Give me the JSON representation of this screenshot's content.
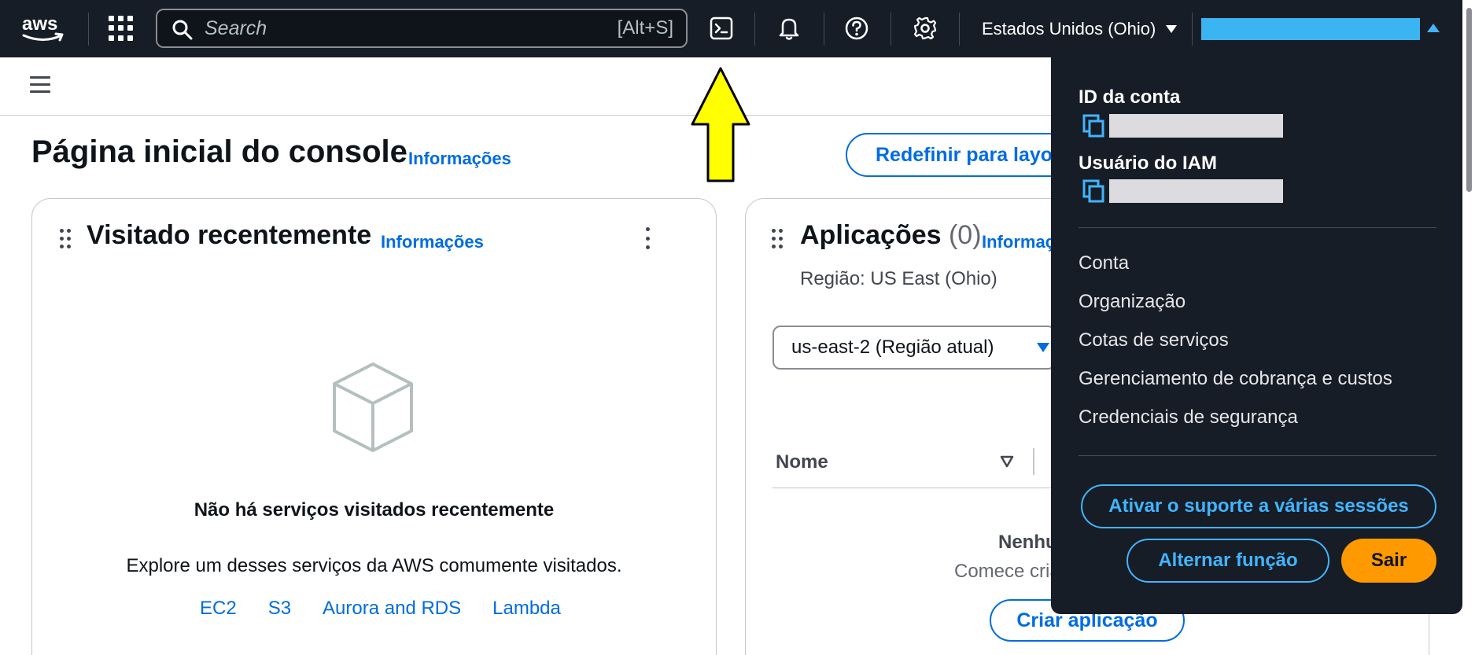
{
  "topnav": {
    "logo_text": "aws",
    "search": {
      "placeholder": "Search",
      "shortcut": "[Alt+S]"
    },
    "region": "Estados Unidos (Ohio)",
    "icons": [
      "services-grid-icon",
      "search-icon",
      "cloudshell-icon",
      "bell-icon",
      "help-icon",
      "gear-icon"
    ],
    "account_bar_color": "#3bb4f2"
  },
  "page": {
    "title": "Página inicial do console",
    "info_link": "Informações",
    "reset_button": "Redefinir para layout padrão"
  },
  "recent_card": {
    "title": "Visitado recentemente",
    "info_link": "Informações",
    "empty_title": "Não há serviços visitados recentemente",
    "empty_desc": "Explore um desses serviços da AWS comumente visitados.",
    "services": [
      "EC2",
      "S3",
      "Aurora and RDS",
      "Lambda"
    ]
  },
  "apps_card": {
    "title": "Aplicações",
    "count": "(0)",
    "info_link": "Informações",
    "region_label": "Região: US East (Ohio)",
    "region_select": "us-east-2 (Região atual)",
    "column_name": "Nome",
    "empty_title": "Nenhuma aplicação",
    "empty_desc": "Comece criando uma aplicação.",
    "create_button": "Criar aplicação"
  },
  "account_menu": {
    "account_id_label": "ID da conta",
    "iam_user_label": "Usuário do IAM",
    "items": [
      "Conta",
      "Organização",
      "Cotas de serviços",
      "Gerenciamento de cobrança e custos",
      "Credenciais de segurança"
    ],
    "multi_session_button": "Ativar o suporte a várias sessões",
    "switch_role_button": "Alternar função",
    "sign_out_button": "Sair"
  },
  "colors": {
    "nav_bg": "#161d26",
    "link_blue": "#006ce0",
    "dropdown_link": "#42b4ff",
    "signout_orange": "#ff9900",
    "annotation_arrow": "#ffff00"
  }
}
